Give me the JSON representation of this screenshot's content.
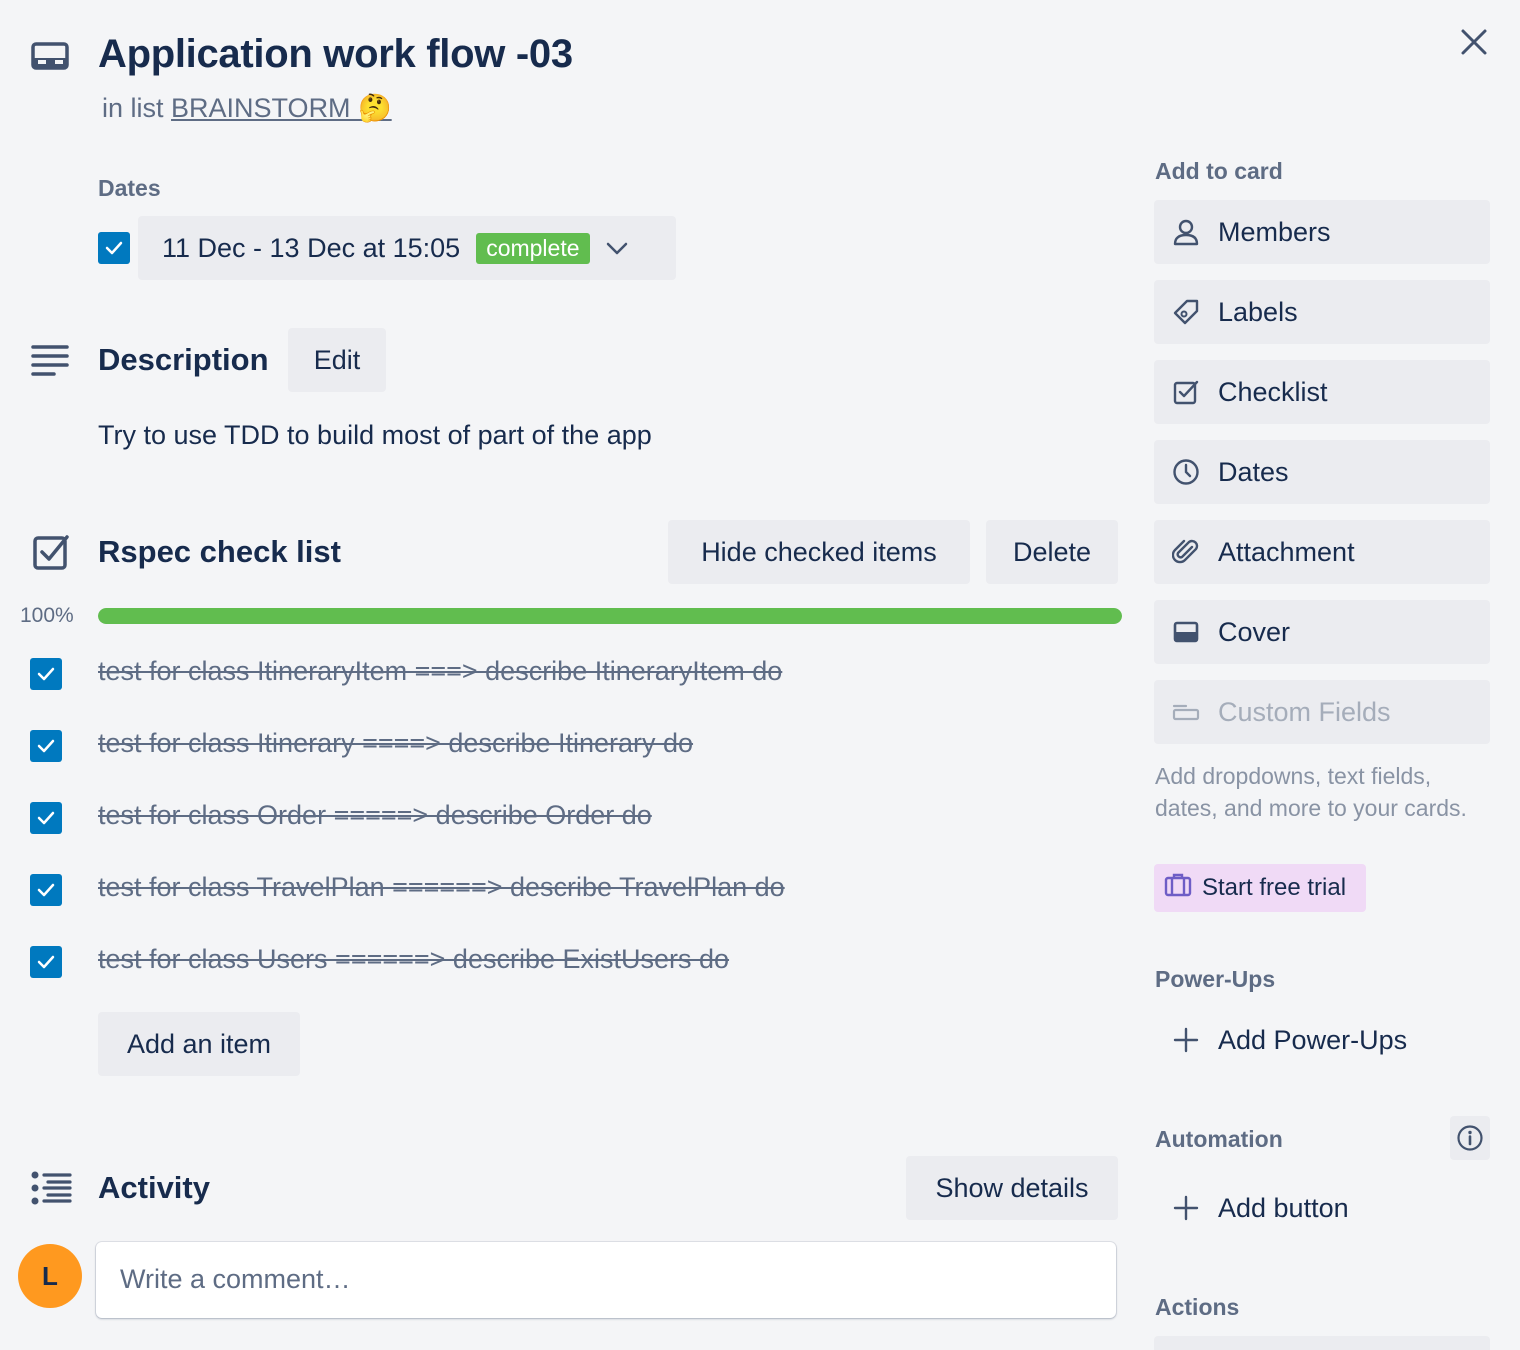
{
  "card": {
    "title": "Application work flow -03",
    "in_list_prefix": "in list",
    "list_name": "BRAINSTORM 🤔"
  },
  "dates": {
    "label": "Dates",
    "checked": true,
    "range": "11 Dec - 13 Dec at 15:05",
    "status": "complete",
    "status_color": "#61bd4f"
  },
  "description": {
    "title": "Description",
    "edit_label": "Edit",
    "text": "Try to use TDD to build most of part of the app"
  },
  "checklist": {
    "title": "Rspec check list",
    "hide_label": "Hide checked items",
    "delete_label": "Delete",
    "progress_text": "100%",
    "progress": 1.0,
    "items": [
      {
        "text": "test for class ItineraryItem ===> describe ItineraryItem do",
        "checked": true
      },
      {
        "text": "test for class Itinerary ====> describe Itinerary do",
        "checked": true
      },
      {
        "text": "test for class Order =====> describe Order do",
        "checked": true
      },
      {
        "text": "test for class TravelPlan ======> describe TravelPlan do",
        "checked": true
      },
      {
        "text": "test for class Users ======> describe ExistUsers do",
        "checked": true
      }
    ],
    "add_item_label": "Add an item"
  },
  "activity": {
    "title": "Activity",
    "show_details_label": "Show details",
    "avatar_initial": "L",
    "avatar_color": "#ff991f",
    "comment_placeholder": "Write a comment…"
  },
  "sidebar": {
    "add_to_card_label": "Add to card",
    "buttons": [
      {
        "label": "Members",
        "icon": "person-icon"
      },
      {
        "label": "Labels",
        "icon": "tag-icon"
      },
      {
        "label": "Checklist",
        "icon": "checkbox-icon"
      },
      {
        "label": "Dates",
        "icon": "clock-icon"
      },
      {
        "label": "Attachment",
        "icon": "paperclip-icon"
      },
      {
        "label": "Cover",
        "icon": "cover-icon"
      },
      {
        "label": "Custom Fields",
        "icon": "custom-fields-icon",
        "disabled": true
      }
    ],
    "custom_fields_note": "Add dropdowns, text fields, dates, and more to your cards.",
    "trial_label": "Start free trial",
    "powerups_label": "Power-Ups",
    "add_powerups_label": "Add Power-Ups",
    "automation_label": "Automation",
    "add_button_label": "Add button",
    "actions_label": "Actions"
  },
  "colors": {
    "accent": "#0079bf",
    "text": "#172b4d",
    "muted": "#5e6c84",
    "button_bg": "#ebecf0",
    "page_bg": "#f4f5f7"
  }
}
